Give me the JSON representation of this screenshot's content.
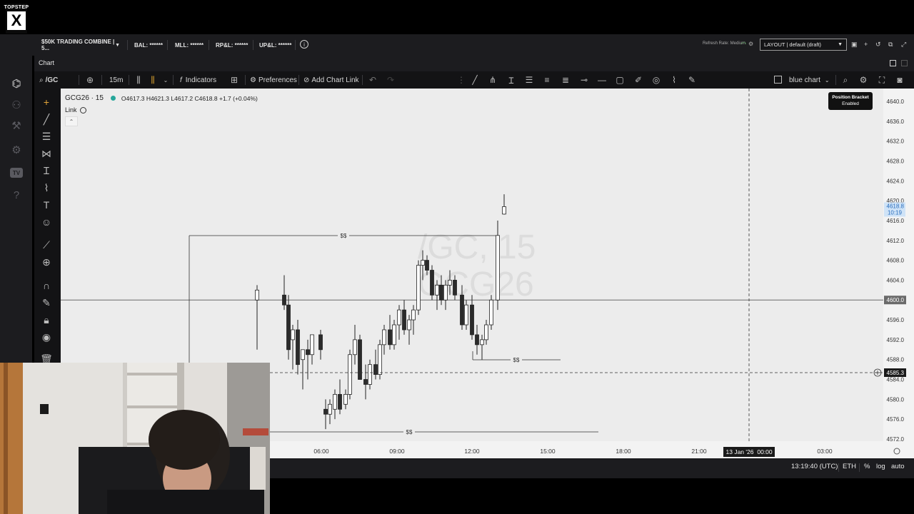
{
  "app": {
    "logo_text": "TOPSTEP",
    "logo_mark": "X",
    "account_select": "$50K TRADING COMBINE | 5...",
    "stats": [
      {
        "label": "BAL: ******"
      },
      {
        "label": "MLL: ******"
      },
      {
        "label": "RP&L: ******"
      },
      {
        "label": "UP&L: ******"
      }
    ],
    "refresh_rate": "Refresh Rate: Medium",
    "layout_select": "LAYOUT | default (draft)"
  },
  "panel": {
    "title": "Chart"
  },
  "toolbar": {
    "symbol": "/GC",
    "interval": "15m",
    "indicators": "Indicators",
    "preferences": "Preferences",
    "add_chart_link": "Add Chart Link",
    "template": "blue chart"
  },
  "chart": {
    "symbol_label": "GCG26 · 15",
    "ohlc": "O4617.3  H4621.3  L4617.2  C4618.8  +1.7 (+0.04%)",
    "link_label": "Link",
    "watermark_line1": "/GC, 15",
    "watermark_line2": "GCG26",
    "tooltip_title": "Position Bracket",
    "tooltip_sub": "Enabled",
    "level_label": "$$",
    "price_ticks": [
      "4640.0",
      "4636.0",
      "4632.0",
      "4628.0",
      "4624.0",
      "4620.0",
      "4616.0",
      "4612.0",
      "4608.0",
      "4604.0",
      "4596.0",
      "4592.0",
      "4588.0",
      "4584.0",
      "4580.0",
      "4576.0",
      "4572.0"
    ],
    "last_price": "4618.8",
    "countdown": "10:19",
    "hline_price": "4600.0",
    "crosshair_price": "4585.3",
    "time_ticks": [
      "06:00",
      "09:00",
      "12:00",
      "15:00",
      "18:00",
      "21:00",
      "03:00"
    ],
    "crosshair_time": "13 Jan '26",
    "crosshair_time2": "00:00"
  },
  "chart_data": {
    "type": "candlestick",
    "ylim": [
      4570,
      4642
    ],
    "candles": [
      {
        "o": 4600,
        "h": 4603,
        "l": 4590,
        "c": 4602
      },
      {
        "o": 4601,
        "h": 4605,
        "l": 4598,
        "c": 4599
      },
      {
        "o": 4599,
        "h": 4601,
        "l": 4588,
        "c": 4590
      },
      {
        "o": 4592,
        "h": 4595,
        "l": 4586,
        "c": 4594
      },
      {
        "o": 4594,
        "h": 4596,
        "l": 4585,
        "c": 4587
      },
      {
        "o": 4588,
        "h": 4590,
        "l": 4582,
        "c": 4590
      },
      {
        "o": 4590,
        "h": 4592,
        "l": 4584,
        "c": 4589
      },
      {
        "o": 4589,
        "h": 4593,
        "l": 4587,
        "c": 4593
      },
      {
        "o": 4593,
        "h": 4594,
        "l": 4588,
        "c": 4590
      },
      {
        "o": 4578,
        "h": 4580,
        "l": 4574,
        "c": 4577
      },
      {
        "o": 4577,
        "h": 4580,
        "l": 4575,
        "c": 4579
      },
      {
        "o": 4578,
        "h": 4582,
        "l": 4576,
        "c": 4581
      },
      {
        "o": 4581,
        "h": 4584,
        "l": 4577,
        "c": 4578
      },
      {
        "o": 4579,
        "h": 4582,
        "l": 4578,
        "c": 4581
      },
      {
        "o": 4581,
        "h": 4590,
        "l": 4580,
        "c": 4589
      },
      {
        "o": 4589,
        "h": 4595,
        "l": 4587,
        "c": 4592
      },
      {
        "o": 4592,
        "h": 4593,
        "l": 4584,
        "c": 4584
      },
      {
        "o": 4584,
        "h": 4587,
        "l": 4580,
        "c": 4583
      },
      {
        "o": 4583,
        "h": 4588,
        "l": 4582,
        "c": 4587
      },
      {
        "o": 4587,
        "h": 4590,
        "l": 4584,
        "c": 4585
      },
      {
        "o": 4585,
        "h": 4592,
        "l": 4584,
        "c": 4591
      },
      {
        "o": 4591,
        "h": 4595,
        "l": 4589,
        "c": 4594
      },
      {
        "o": 4594,
        "h": 4597,
        "l": 4590,
        "c": 4591
      },
      {
        "o": 4591,
        "h": 4596,
        "l": 4590,
        "c": 4595
      },
      {
        "o": 4595,
        "h": 4599,
        "l": 4592,
        "c": 4598
      },
      {
        "o": 4598,
        "h": 4600,
        "l": 4593,
        "c": 4594
      },
      {
        "o": 4594,
        "h": 4597,
        "l": 4591,
        "c": 4596
      },
      {
        "o": 4596,
        "h": 4599,
        "l": 4593,
        "c": 4598
      },
      {
        "o": 4598,
        "h": 4608,
        "l": 4597,
        "c": 4607
      },
      {
        "o": 4607,
        "h": 4610,
        "l": 4604,
        "c": 4608
      },
      {
        "o": 4608,
        "h": 4609,
        "l": 4605,
        "c": 4606
      },
      {
        "o": 4606,
        "h": 4607,
        "l": 4600,
        "c": 4601
      },
      {
        "o": 4601,
        "h": 4604,
        "l": 4598,
        "c": 4603
      },
      {
        "o": 4603,
        "h": 4605,
        "l": 4599,
        "c": 4600
      },
      {
        "o": 4600,
        "h": 4604,
        "l": 4598,
        "c": 4603
      },
      {
        "o": 4603,
        "h": 4606,
        "l": 4601,
        "c": 4604
      },
      {
        "o": 4604,
        "h": 4605,
        "l": 4600,
        "c": 4601
      },
      {
        "o": 4601,
        "h": 4603,
        "l": 4594,
        "c": 4595
      },
      {
        "o": 4595,
        "h": 4600,
        "l": 4594,
        "c": 4599
      },
      {
        "o": 4599,
        "h": 4601,
        "l": 4592,
        "c": 4593
      },
      {
        "o": 4593,
        "h": 4595,
        "l": 4589,
        "c": 4591
      },
      {
        "o": 4591,
        "h": 4593,
        "l": 4588,
        "c": 4592
      },
      {
        "o": 4592,
        "h": 4596,
        "l": 4591,
        "c": 4595
      },
      {
        "o": 4595,
        "h": 4601,
        "l": 4594,
        "c": 4600
      },
      {
        "o": 4600,
        "h": 4616,
        "l": 4598,
        "c": 4613
      },
      {
        "o": 4617.3,
        "h": 4621.3,
        "l": 4617.2,
        "c": 4618.8
      }
    ]
  }
}
